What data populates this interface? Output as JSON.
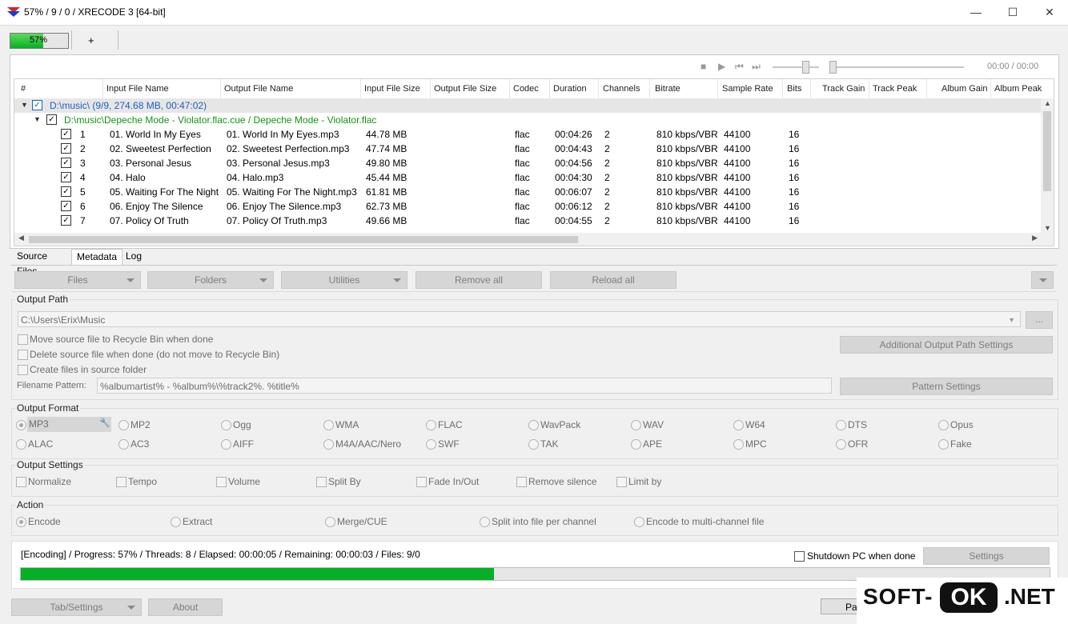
{
  "window": {
    "title": "57% / 9 / 0 / XRECODE 3 [64-bit]",
    "minimize": "—",
    "maximize": "☐",
    "close": "✕"
  },
  "topbar": {
    "progress_text": "57%",
    "progress_fraction": 0.57,
    "plus": "+"
  },
  "player": {
    "stop": "■",
    "play": "▶",
    "prev": "⏮",
    "next": "⏭",
    "time": "00:00 / 00:00"
  },
  "table": {
    "columns": [
      "#",
      "Input File Name",
      "Output File Name",
      "Input File Size",
      "Output File Size",
      "Codec",
      "Duration",
      "Channels",
      "Bitrate",
      "Sample Rate",
      "Bits",
      "Track Gain",
      "Track Peak",
      "Album Gain",
      "Album Peak"
    ],
    "folder": "D:\\music\\ (9/9, 274.68 MB, 00:47:02)",
    "cue": "D:\\music\\Depeche Mode - Violator.flac.cue / Depeche Mode - Violator.flac",
    "rows": [
      {
        "n": "1",
        "in": "01. World In My Eyes",
        "out": "01. World In My Eyes.mp3",
        "size": "44.78 MB",
        "codec": "flac",
        "dur": "00:04:26",
        "ch": "2",
        "br": "810 kbps/VBR",
        "sr": "44100",
        "bits": "16"
      },
      {
        "n": "2",
        "in": "02. Sweetest Perfection",
        "out": "02. Sweetest Perfection.mp3",
        "size": "47.74 MB",
        "codec": "flac",
        "dur": "00:04:43",
        "ch": "2",
        "br": "810 kbps/VBR",
        "sr": "44100",
        "bits": "16"
      },
      {
        "n": "3",
        "in": "03. Personal Jesus",
        "out": "03. Personal Jesus.mp3",
        "size": "49.80 MB",
        "codec": "flac",
        "dur": "00:04:56",
        "ch": "2",
        "br": "810 kbps/VBR",
        "sr": "44100",
        "bits": "16"
      },
      {
        "n": "4",
        "in": "04. Halo",
        "out": "04. Halo.mp3",
        "size": "45.44 MB",
        "codec": "flac",
        "dur": "00:04:30",
        "ch": "2",
        "br": "810 kbps/VBR",
        "sr": "44100",
        "bits": "16"
      },
      {
        "n": "5",
        "in": "05. Waiting For The Night",
        "out": "05. Waiting For The Night.mp3",
        "size": "61.81 MB",
        "codec": "flac",
        "dur": "00:06:07",
        "ch": "2",
        "br": "810 kbps/VBR",
        "sr": "44100",
        "bits": "16"
      },
      {
        "n": "6",
        "in": "06. Enjoy The Silence",
        "out": "06. Enjoy The Silence.mp3",
        "size": "62.73 MB",
        "codec": "flac",
        "dur": "00:06:12",
        "ch": "2",
        "br": "810 kbps/VBR",
        "sr": "44100",
        "bits": "16"
      },
      {
        "n": "7",
        "in": "07. Policy Of Truth",
        "out": "07. Policy Of Truth.mp3",
        "size": "49.66 MB",
        "codec": "flac",
        "dur": "00:04:55",
        "ch": "2",
        "br": "810 kbps/VBR",
        "sr": "44100",
        "bits": "16"
      }
    ]
  },
  "tabs": [
    "Source Files",
    "Metadata",
    "Log"
  ],
  "actions": {
    "files": "Files",
    "folders": "Folders",
    "utilities": "Utilities",
    "remove_all": "Remove all",
    "reload_all": "Reload all"
  },
  "output_path": {
    "title": "Output Path",
    "path": "C:\\Users\\Erix\\Music",
    "browse": "...",
    "move_recycle": "Move source file to Recycle Bin when done",
    "delete_source": "Delete source file when done (do not move to Recycle Bin)",
    "create_in_source": "Create files in source folder",
    "additional": "Additional Output Path Settings",
    "filename_label": "Filename Pattern:",
    "filename_pattern": "%albumartist% - %album%\\%track2%. %title%",
    "pattern_settings": "Pattern Settings"
  },
  "output_format": {
    "title": "Output Format",
    "row1": [
      "MP3",
      "MP2",
      "Ogg",
      "WMA",
      "FLAC",
      "WavPack",
      "WAV",
      "W64",
      "DTS",
      "Opus"
    ],
    "row2": [
      "ALAC",
      "AC3",
      "AIFF",
      "M4A/AAC/Nero",
      "SWF",
      "TAK",
      "APE",
      "MPC",
      "OFR",
      "Fake"
    ]
  },
  "output_settings": {
    "title": "Output Settings",
    "items": [
      "Normalize",
      "Tempo",
      "Volume",
      "Split By",
      "Fade In/Out",
      "Remove silence",
      "Limit by"
    ]
  },
  "action": {
    "title": "Action",
    "items": [
      "Encode",
      "Extract",
      "Merge/CUE",
      "Split into file per channel",
      "Encode to multi-channel file"
    ]
  },
  "status": {
    "text": "[Encoding] / Progress: 57% / Threads: 8 / Elapsed: 00:00:05 / Remaining: 00:00:03 / Files: 9/0",
    "shutdown": "Shutdown PC when done",
    "settings": "Settings",
    "progress_fraction": 0.46
  },
  "bottom": {
    "tab_settings": "Tab/Settings",
    "about": "About",
    "partial": "Pa"
  },
  "watermark": {
    "soft": "SOFT-",
    "ok": "OK",
    "net": ".NET"
  }
}
